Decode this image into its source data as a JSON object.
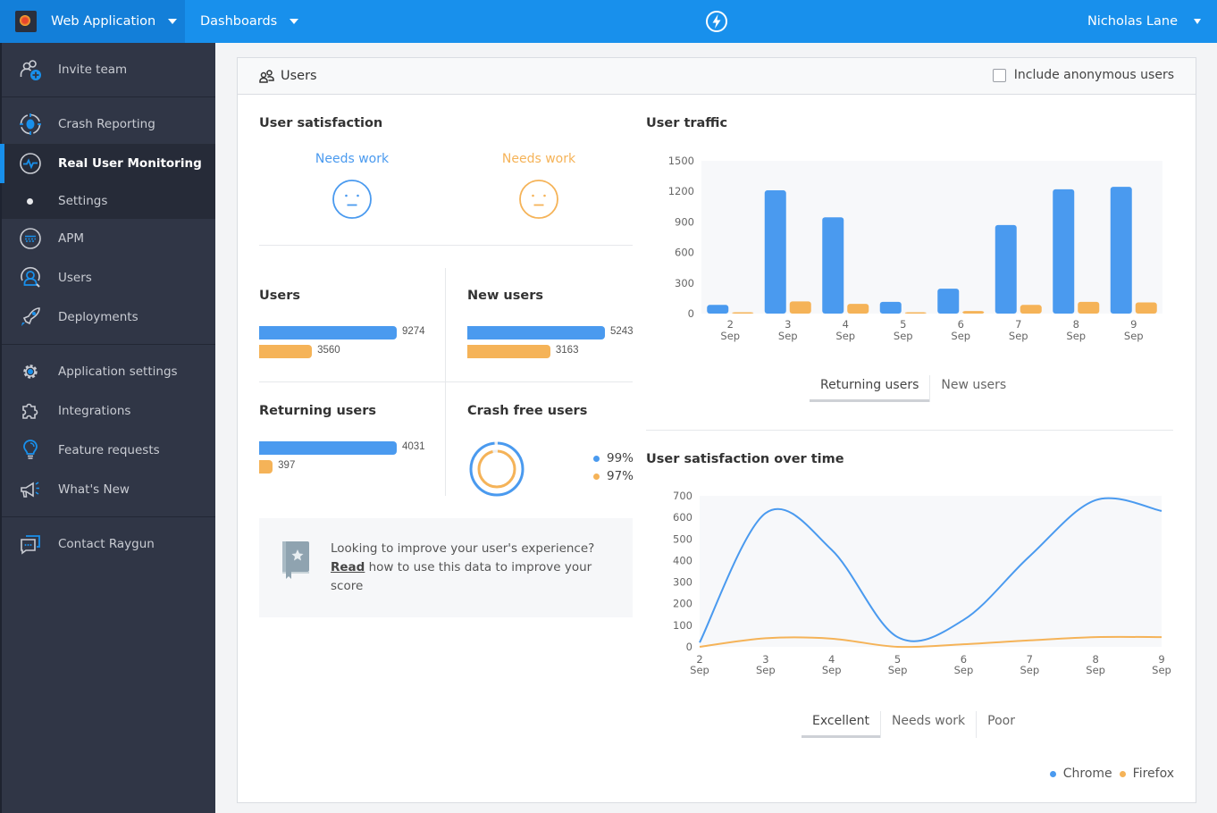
{
  "topbar": {
    "app_name": "Web Application",
    "dashboards_label": "Dashboards",
    "user_name": "Nicholas Lane",
    "brand_color": "#1890ec"
  },
  "sidebar": {
    "items": [
      {
        "label": "Invite team",
        "icon": "invite-team-icon"
      },
      {
        "label": "Crash Reporting",
        "icon": "crash-reporting-icon"
      },
      {
        "label": "Real User Monitoring",
        "icon": "pulse-icon",
        "active": true
      },
      {
        "label": "Settings",
        "icon": "bullet-icon",
        "sub": true
      },
      {
        "label": "APM",
        "icon": "apm-icon"
      },
      {
        "label": "Users",
        "icon": "users-icon"
      },
      {
        "label": "Deployments",
        "icon": "rocket-icon"
      },
      {
        "label": "Application settings",
        "icon": "gear-icon"
      },
      {
        "label": "Integrations",
        "icon": "puzzle-icon"
      },
      {
        "label": "Feature requests",
        "icon": "lightbulb-icon"
      },
      {
        "label": "What's New",
        "icon": "megaphone-icon"
      },
      {
        "label": "Contact Raygun",
        "icon": "chat-icon"
      }
    ]
  },
  "card": {
    "title": "Users",
    "include_anonymous_label": "Include anonymous users",
    "include_anonymous_checked": false
  },
  "satisfaction": {
    "title": "User satisfaction",
    "chrome_label": "Needs work",
    "firefox_label": "Needs work"
  },
  "stats": {
    "users": {
      "title": "Users",
      "chrome": 9274,
      "firefox": 3560
    },
    "new_users": {
      "title": "New users",
      "chrome": 5243,
      "firefox": 3163
    },
    "returning_users": {
      "title": "Returning users",
      "chrome": 4031,
      "firefox": 397
    },
    "crash_free": {
      "title": "Crash free users",
      "chrome_pct": "99%",
      "firefox_pct": "97%",
      "chrome_value": 99,
      "firefox_value": 97
    }
  },
  "tip": {
    "line1": "Looking to improve your user's experience?",
    "link": "Read",
    "line2": " how to use this data to improve your score"
  },
  "traffic_tabs": [
    {
      "label": "Returning users",
      "active": true
    },
    {
      "label": "New users",
      "active": false
    }
  ],
  "satisfaction_tabs": [
    {
      "label": "Excellent",
      "active": true
    },
    {
      "label": "Needs work",
      "active": false
    },
    {
      "label": "Poor",
      "active": false
    }
  ],
  "legend": {
    "chrome": "Chrome",
    "firefox": "Firefox",
    "chrome_color": "#4a9aef",
    "firefox_color": "#f5b358"
  },
  "chart_data": [
    {
      "type": "bar",
      "title": "User traffic",
      "categories": [
        "2\nSep",
        "3\nSep",
        "4\nSep",
        "5\nSep",
        "6\nSep",
        "7\nSep",
        "8\nSep",
        "9\nSep"
      ],
      "category_days": [
        "2",
        "3",
        "4",
        "5",
        "6",
        "7",
        "8",
        "9"
      ],
      "category_month": "Sep",
      "series": [
        {
          "name": "Chrome",
          "color": "#4a9aef",
          "values": [
            85,
            1210,
            945,
            115,
            245,
            870,
            1220,
            1245
          ]
        },
        {
          "name": "Firefox",
          "color": "#f5b358",
          "values": [
            5,
            120,
            95,
            10,
            25,
            85,
            115,
            110
          ]
        }
      ],
      "yticks": [
        0,
        300,
        600,
        900,
        1200,
        1500
      ],
      "ylim": [
        0,
        1500
      ],
      "xlabel": "",
      "ylabel": "",
      "grid": false
    },
    {
      "type": "line",
      "title": "User satisfaction over time",
      "categories": [
        "2\nSep",
        "3\nSep",
        "4\nSep",
        "5\nSep",
        "6\nSep",
        "7\nSep",
        "8\nSep",
        "9\nSep"
      ],
      "category_days": [
        "2",
        "3",
        "4",
        "5",
        "6",
        "7",
        "8",
        "9"
      ],
      "category_month": "Sep",
      "series": [
        {
          "name": "Chrome",
          "color": "#4a9aef",
          "values": [
            20,
            620,
            450,
            45,
            125,
            420,
            680,
            630
          ]
        },
        {
          "name": "Firefox",
          "color": "#f5b358",
          "values": [
            0,
            40,
            38,
            0,
            12,
            30,
            45,
            45
          ]
        }
      ],
      "yticks": [
        0,
        100,
        200,
        300,
        400,
        500,
        600,
        700
      ],
      "ylim": [
        0,
        700
      ],
      "xlabel": "",
      "ylabel": "",
      "grid": false,
      "legend": "bottom-right"
    }
  ]
}
